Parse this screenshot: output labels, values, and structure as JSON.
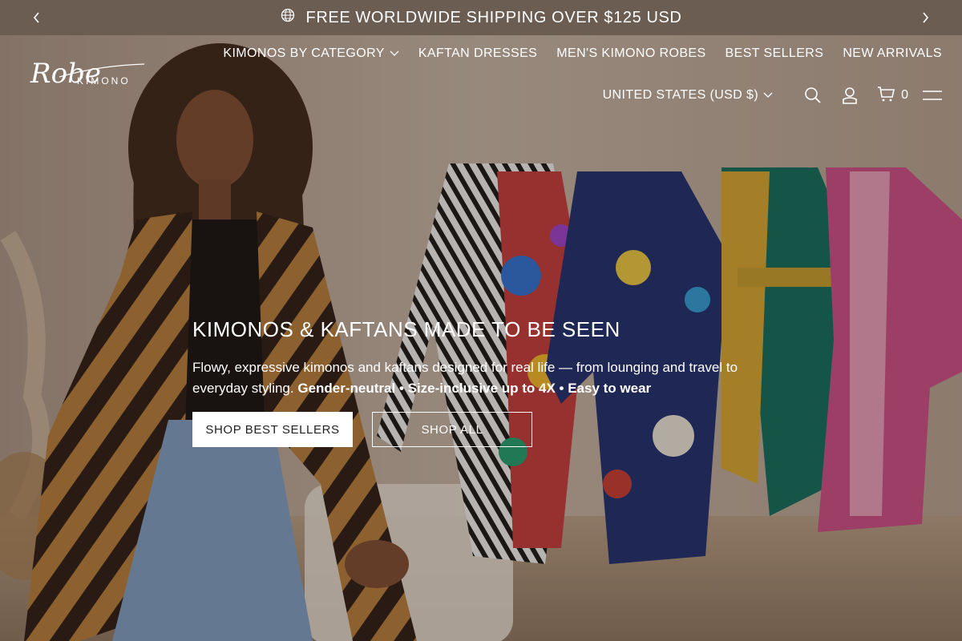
{
  "announcement": {
    "message": "FREE WORLDWIDE SHIPPING OVER $125 USD",
    "icon": "globe-icon",
    "prev_icon": "chevron-left-icon",
    "next_icon": "chevron-right-icon"
  },
  "brand": {
    "script": "Robe",
    "word": "KIMONO"
  },
  "nav": {
    "items": [
      {
        "label": "KIMONOS BY CATEGORY",
        "has_dropdown": true
      },
      {
        "label": "KAFTAN DRESSES"
      },
      {
        "label": "MEN'S KIMONO ROBES"
      },
      {
        "label": "BEST SELLERS"
      },
      {
        "label": "NEW ARRIVALS"
      }
    ]
  },
  "utility": {
    "currency": "UNITED STATES (USD $)",
    "cart_count": "0",
    "icons": [
      "search-icon",
      "account-icon",
      "cart-icon",
      "menu-icon"
    ]
  },
  "hero": {
    "headline": "KIMONOS & KAFTANS MADE TO BE SEEN",
    "body": "Flowy, expressive kimonos and kaftans designed for real life — from lounging and travel to everyday styling.",
    "highlights": "Gender-neutral • Size-inclusive up to 4X • Easy to wear",
    "primary_cta": "SHOP BEST SELLERS",
    "secondary_cta": "SHOP ALL"
  },
  "colors": {
    "announcement_bg": "#6b5d52",
    "button_bg": "#ffffff",
    "button_text": "#222222"
  }
}
